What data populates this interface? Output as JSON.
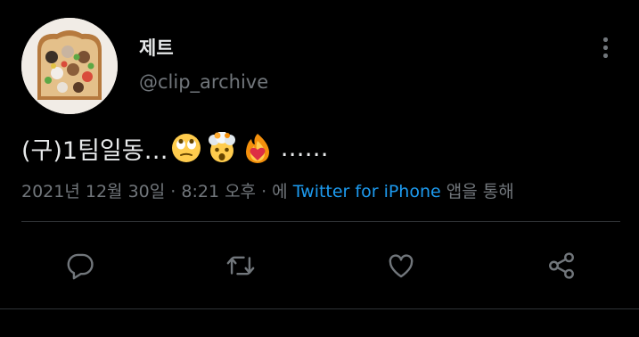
{
  "user": {
    "display_name": "제트",
    "handle": "@clip_archive",
    "avatar_icon": "toast-avatar-image"
  },
  "more_icon": "more-vertical-icon",
  "tweet": {
    "text_before_emoji": "(구)1팀일동…",
    "emojis": [
      "eye-roll-emoji",
      "mind-blown-emoji",
      "heart-on-fire-emoji"
    ],
    "text_after_emoji": "……"
  },
  "meta": {
    "date": "2021년 12월 30일",
    "separator_1": " · ",
    "time": "8:21 오후",
    "separator_2": " · ",
    "prefix": "에 ",
    "source": "Twitter for iPhone",
    "suffix": " 앱을 통해"
  },
  "actions": [
    {
      "icon": "reply-icon"
    },
    {
      "icon": "retweet-icon"
    },
    {
      "icon": "like-icon"
    },
    {
      "icon": "share-icon"
    }
  ],
  "colors": {
    "background": "#000000",
    "text_primary": "#e7e9ea",
    "text_secondary": "#71767b",
    "link": "#1d9bf0",
    "divider": "#2f3336"
  }
}
